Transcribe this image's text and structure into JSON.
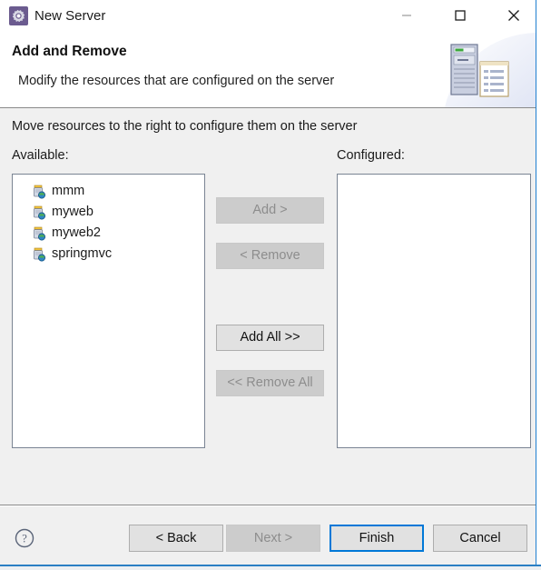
{
  "window": {
    "title": "New Server",
    "icon": "server-gear-icon",
    "controls": {
      "minimize": "minimize-icon",
      "maximize": "maximize-icon",
      "close": "close-icon"
    },
    "accent_color": "#0078d7",
    "border_color": "#1f7fd0"
  },
  "header": {
    "title": "Add and Remove",
    "subtitle": "Modify the resources that are configured on the server",
    "banner_icon": "server-and-document-icon"
  },
  "main": {
    "instruction": "Move resources to the right to configure them on the server",
    "available": {
      "label": "Available:",
      "items": [
        {
          "label": "mmm",
          "icon": "web-module-icon"
        },
        {
          "label": "myweb",
          "icon": "web-module-icon"
        },
        {
          "label": "myweb2",
          "icon": "web-module-icon"
        },
        {
          "label": "springmvc",
          "icon": "web-module-icon"
        }
      ]
    },
    "configured": {
      "label": "Configured:",
      "items": []
    },
    "transfer_buttons": [
      {
        "label": "Add >",
        "enabled": false
      },
      {
        "label": "< Remove",
        "enabled": false
      },
      {
        "label": "Add All >>",
        "enabled": true
      },
      {
        "label": "<< Remove All",
        "enabled": false
      }
    ]
  },
  "footer": {
    "help": "help-icon",
    "buttons": [
      {
        "label": "< Back",
        "state": "enabled"
      },
      {
        "label": "Next >",
        "state": "disabled"
      },
      {
        "label": "Finish",
        "state": "default"
      },
      {
        "label": "Cancel",
        "state": "enabled"
      }
    ]
  }
}
